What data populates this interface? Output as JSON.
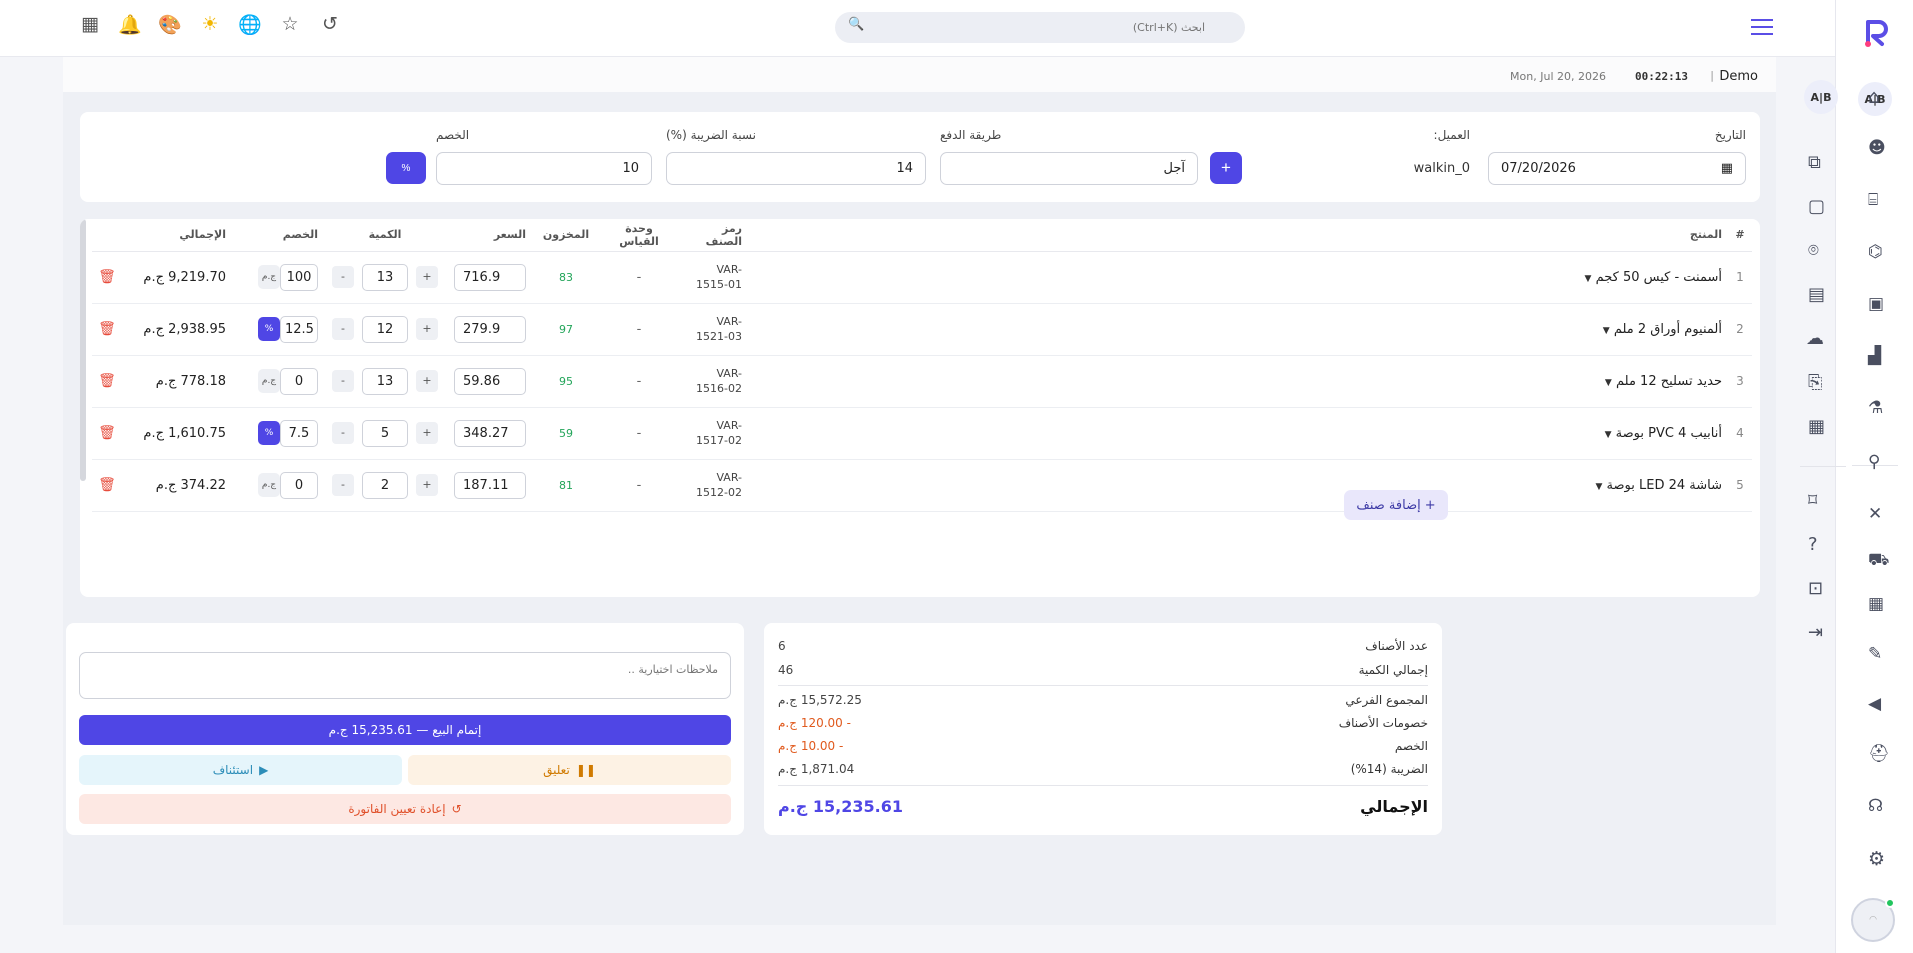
{
  "header": {
    "search_placeholder": "ابحث (Ctrl+K)"
  },
  "infobar": {
    "company": "Demo",
    "separator": "|",
    "time": "00:22:13",
    "date": "Mon, Jul 20, 2026"
  },
  "form": {
    "date_label": "التاريخ",
    "date_value": "07/20/2026",
    "customer_label": "العميل:",
    "customer_value": "walkin_0",
    "payment_label": "طريقة الدفع",
    "payment_value": "آجل",
    "tax_label": "نسبة الضريبة (%)",
    "tax_value": "14",
    "discount_label": "الخصم",
    "discount_value": "10",
    "discount_toggle": "%",
    "add_symbol": "+"
  },
  "table": {
    "headers": [
      "#",
      "المنتج",
      "رمز الصنف",
      "وحدة القياس",
      "المخزون",
      "السعر",
      "الكمية",
      "الخصم",
      "الإجمالي"
    ],
    "rows": [
      {
        "n": "1",
        "product": "أسمنت - كيس 50 كجم",
        "sku1": "VAR-",
        "sku2": "1515-01",
        "unit": "-",
        "stock": "83",
        "price": "716.9",
        "qty": "13",
        "disc": "100",
        "disc_type": "ج.م",
        "total": "9,219.70 ج.م"
      },
      {
        "n": "2",
        "product": "ألمنيوم أوراق 2 ملم",
        "sku1": "VAR-",
        "sku2": "1521-03",
        "unit": "-",
        "stock": "97",
        "price": "279.9",
        "qty": "12",
        "disc": "12.5",
        "disc_type": "%",
        "total": "2,938.95 ج.م"
      },
      {
        "n": "3",
        "product": "حديد تسليح 12 ملم",
        "sku1": "VAR-",
        "sku2": "1516-02",
        "unit": "-",
        "stock": "95",
        "price": "59.86",
        "qty": "13",
        "disc": "0",
        "disc_type": "ج.م",
        "total": "778.18 ج.م"
      },
      {
        "n": "4",
        "product": "أنابيب PVC 4 بوصة",
        "sku1": "VAR-",
        "sku2": "1517-02",
        "unit": "-",
        "stock": "59",
        "price": "348.27",
        "qty": "5",
        "disc": "7.5",
        "disc_type": "%",
        "total": "1,610.75 ج.م"
      },
      {
        "n": "5",
        "product": "شاشة LED 24 بوصة",
        "sku1": "VAR-",
        "sku2": "1512-02",
        "unit": "-",
        "stock": "81",
        "price": "187.11",
        "qty": "2",
        "disc": "0",
        "disc_type": "ج.م",
        "total": "374.22 ج.م"
      }
    ],
    "minus": "-",
    "plus": "+",
    "add_item": "إضافة صنف"
  },
  "summary": {
    "items_count_label": "عدد الأصناف",
    "items_count": "6",
    "total_qty_label": "إجمالي الكمية",
    "total_qty": "46",
    "subtotal_label": "المجموع الفرعي",
    "subtotal": "15,572.25 ج.م",
    "item_disc_label": "خصومات الأصناف",
    "item_disc": "- 120.00 ج.م",
    "disc_label": "الخصم",
    "disc": "- 10.00 ج.م",
    "tax_label": "الضريبة (14%)",
    "tax": "1,871.04 ج.م",
    "grand_label": "الإجمالي",
    "grand": "15,235.61 ج.م"
  },
  "actions": {
    "notes_placeholder": "ملاحظات اختيارية ..",
    "complete": "إتمام البيع — 15,235.61 ج.م",
    "suspend": "تعليق",
    "resume": "استئناف",
    "reset": "إعادة تعيين الفاتورة"
  },
  "icons": {
    "accent": "#4f46e5"
  }
}
